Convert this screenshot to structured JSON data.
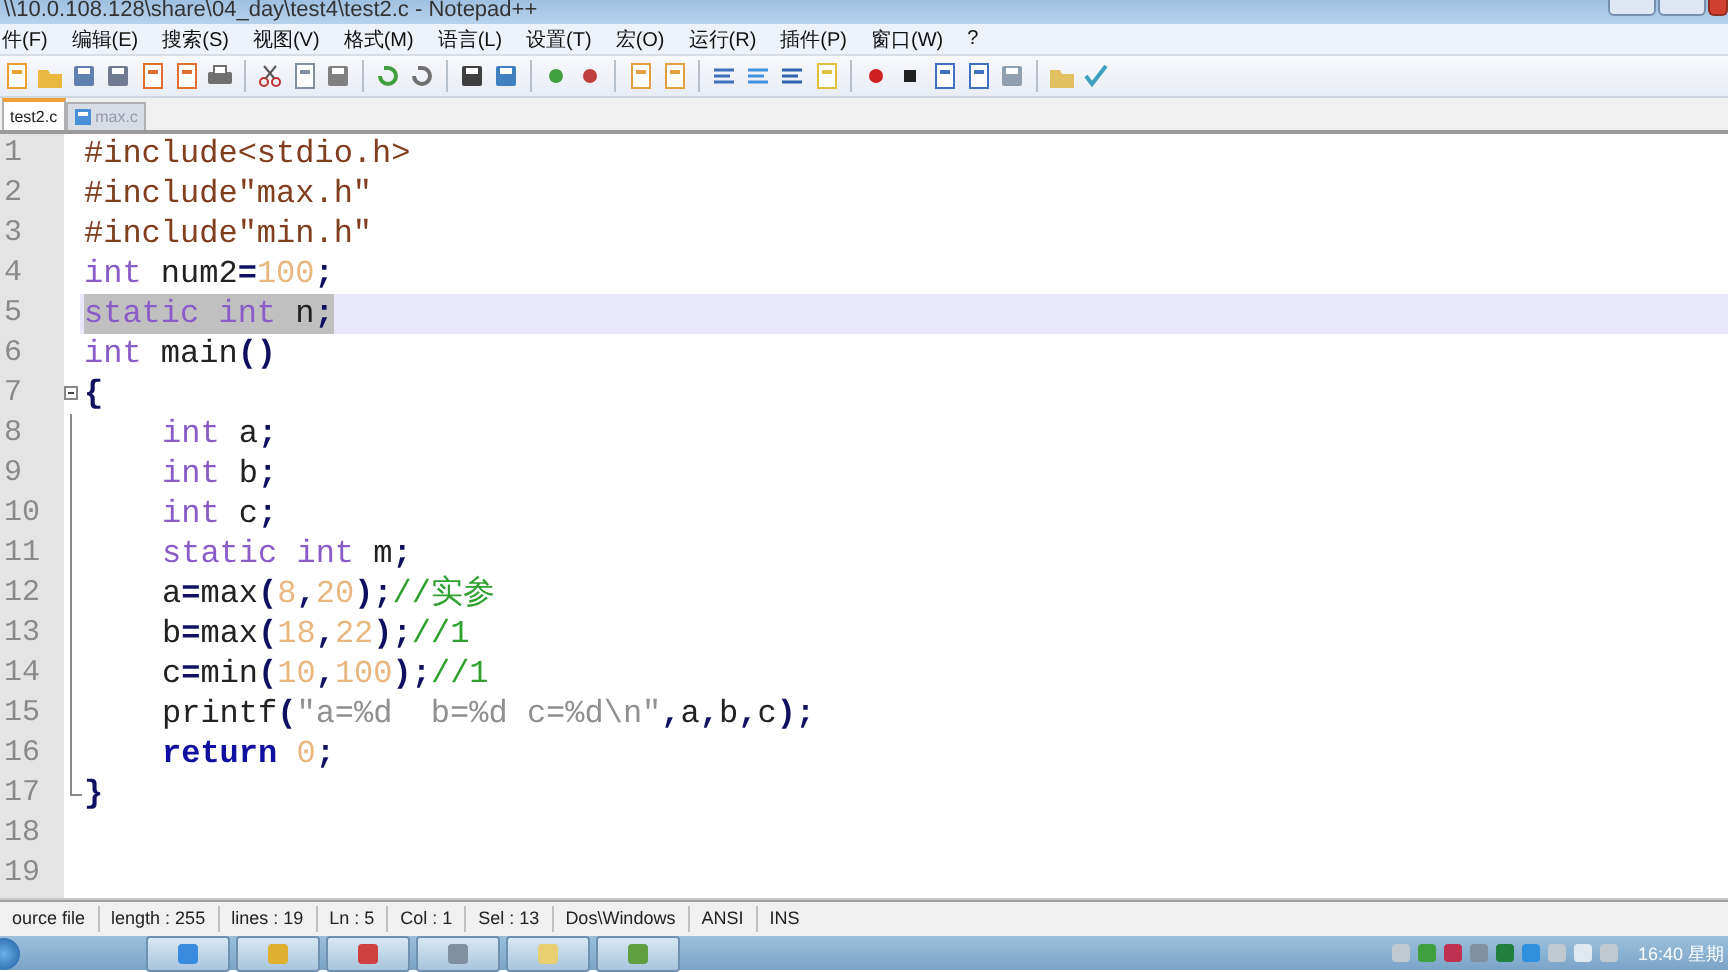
{
  "window": {
    "title": "\\\\10.0.108.128\\share\\04_day\\test4\\test2.c - Notepad++"
  },
  "menu": [
    "件(F)",
    "编辑(E)",
    "搜索(S)",
    "视图(V)",
    "格式(M)",
    "语言(L)",
    "设置(T)",
    "宏(O)",
    "运行(R)",
    "插件(P)",
    "窗口(W)",
    "?"
  ],
  "tabs": [
    {
      "label": "test2.c",
      "selected": true
    },
    {
      "label": "max.c",
      "selected": false
    }
  ],
  "editor": {
    "lines": [
      {
        "number": "1",
        "selected": false,
        "tokens": [
          {
            "kind": "preproc",
            "text": "#include<stdio.h>"
          }
        ]
      },
      {
        "number": "2",
        "selected": false,
        "tokens": [
          {
            "kind": "preproc",
            "text": "#include\"max.h\""
          }
        ]
      },
      {
        "number": "3",
        "selected": false,
        "tokens": [
          {
            "kind": "preproc",
            "text": "#include\"min.h\""
          }
        ]
      },
      {
        "number": "4",
        "selected": false,
        "tokens": [
          {
            "kind": "keyword",
            "text": "int"
          },
          {
            "kind": "plain",
            "text": " num2"
          },
          {
            "kind": "operator",
            "text": "="
          },
          {
            "kind": "number",
            "text": "100"
          },
          {
            "kind": "operator",
            "text": ";"
          }
        ]
      },
      {
        "number": "5",
        "selected": true,
        "tokens": [
          {
            "kind": "keyword",
            "text": "static int"
          },
          {
            "kind": "plain",
            "text": " n"
          },
          {
            "kind": "operator",
            "text": ";"
          }
        ]
      },
      {
        "number": "6",
        "selected": false,
        "tokens": [
          {
            "kind": "keyword",
            "text": "int"
          },
          {
            "kind": "plain",
            "text": " main"
          },
          {
            "kind": "operator",
            "text": "()"
          }
        ]
      },
      {
        "number": "7",
        "selected": false,
        "expanded": true,
        "tokens": [
          {
            "kind": "operator",
            "text": "{"
          }
        ],
        "children": [
          {
            "number": "8",
            "selected": false,
            "tokens": [
              {
                "kind": "keyword",
                "text": "int"
              },
              {
                "kind": "plain",
                "text": " a"
              },
              {
                "kind": "operator",
                "text": ";"
              }
            ]
          },
          {
            "number": "9",
            "selected": false,
            "tokens": [
              {
                "kind": "keyword",
                "text": "int"
              },
              {
                "kind": "plain",
                "text": " b"
              },
              {
                "kind": "operator",
                "text": ";"
              }
            ]
          },
          {
            "number": "10",
            "selected": false,
            "tokens": [
              {
                "kind": "keyword",
                "text": "int"
              },
              {
                "kind": "plain",
                "text": " c"
              },
              {
                "kind": "operator",
                "text": ";"
              }
            ]
          },
          {
            "number": "11",
            "selected": false,
            "tokens": [
              {
                "kind": "keyword",
                "text": "static int"
              },
              {
                "kind": "plain",
                "text": " m"
              },
              {
                "kind": "operator",
                "text": ";"
              }
            ]
          },
          {
            "number": "12",
            "selected": false,
            "tokens": [
              {
                "kind": "plain",
                "text": "a"
              },
              {
                "kind": "operator",
                "text": "="
              },
              {
                "kind": "plain",
                "text": "max"
              },
              {
                "kind": "operator",
                "text": "("
              },
              {
                "kind": "number",
                "text": "8"
              },
              {
                "kind": "operator",
                "text": ","
              },
              {
                "kind": "number",
                "text": "20"
              },
              {
                "kind": "operator",
                "text": ");"
              },
              {
                "kind": "comment",
                "text": "//实参"
              }
            ]
          },
          {
            "number": "13",
            "selected": false,
            "tokens": [
              {
                "kind": "plain",
                "text": "b"
              },
              {
                "kind": "operator",
                "text": "="
              },
              {
                "kind": "plain",
                "text": "max"
              },
              {
                "kind": "operator",
                "text": "("
              },
              {
                "kind": "number",
                "text": "18"
              },
              {
                "kind": "operator",
                "text": ","
              },
              {
                "kind": "number",
                "text": "22"
              },
              {
                "kind": "operator",
                "text": ");"
              },
              {
                "kind": "comment",
                "text": "//1"
              }
            ]
          },
          {
            "number": "14",
            "selected": false,
            "tokens": [
              {
                "kind": "plain",
                "text": "c"
              },
              {
                "kind": "operator",
                "text": "="
              },
              {
                "kind": "plain",
                "text": "min"
              },
              {
                "kind": "operator",
                "text": "("
              },
              {
                "kind": "number",
                "text": "10"
              },
              {
                "kind": "operator",
                "text": ","
              },
              {
                "kind": "number",
                "text": "100"
              },
              {
                "kind": "operator",
                "text": ");"
              },
              {
                "kind": "comment",
                "text": "//1"
              }
            ]
          },
          {
            "number": "15",
            "selected": false,
            "tokens": [
              {
                "kind": "plain",
                "text": "printf"
              },
              {
                "kind": "operator",
                "text": "("
              },
              {
                "kind": "string",
                "text": "\"a=%d  b=%d c=%d\\n\""
              },
              {
                "kind": "operator",
                "text": ","
              },
              {
                "kind": "plain",
                "text": "a"
              },
              {
                "kind": "operator",
                "text": ","
              },
              {
                "kind": "plain",
                "text": "b"
              },
              {
                "kind": "operator",
                "text": ","
              },
              {
                "kind": "plain",
                "text": "c"
              },
              {
                "kind": "operator",
                "text": ");"
              }
            ]
          },
          {
            "number": "16",
            "selected": false,
            "tokens": [
              {
                "kind": "instruction",
                "text": "return "
              },
              {
                "kind": "number",
                "text": "0"
              },
              {
                "kind": "operator",
                "text": ";"
              }
            ]
          }
        ]
      },
      {
        "number": "17",
        "selected": false,
        "tokens": [
          {
            "kind": "operator",
            "text": "}"
          }
        ]
      },
      {
        "number": "18",
        "selected": false
      },
      {
        "number": "19",
        "selected": false
      }
    ]
  },
  "status_bar": [
    "ource file",
    "length : 255",
    "lines : 19",
    "Ln : 5",
    "Col : 1",
    "Sel : 13",
    "Dos\\Windows",
    "ANSI",
    "INS"
  ],
  "taskbar": {
    "clock": "16:40 星期"
  }
}
